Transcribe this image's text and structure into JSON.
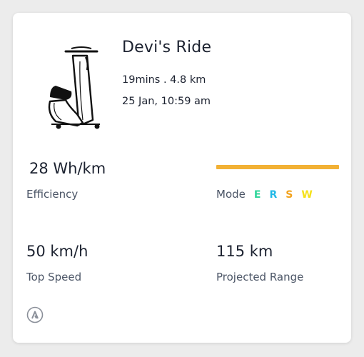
{
  "ride": {
    "title": "Devi's Ride",
    "summary": "19mins . 4.8 km",
    "datetime": "25 Jan, 10:59 am"
  },
  "stats": {
    "efficiency": {
      "value": "28 Wh/km",
      "label": "Efficiency"
    },
    "top_speed": {
      "value": "50 km/h",
      "label": "Top Speed"
    },
    "projected_range": {
      "value": "115 km",
      "label": "Projected Range"
    }
  },
  "mode": {
    "label": "Mode",
    "bar_color": "#f2b135",
    "letters": [
      {
        "text": "E",
        "color": "#2fd59a"
      },
      {
        "text": "R",
        "color": "#22b8e6"
      },
      {
        "text": "S",
        "color": "#f2a21c"
      },
      {
        "text": "W",
        "color": "#f5e11a"
      }
    ]
  },
  "icons": {
    "vehicle": "scooter-icon",
    "brand": "ather-logo-icon"
  }
}
